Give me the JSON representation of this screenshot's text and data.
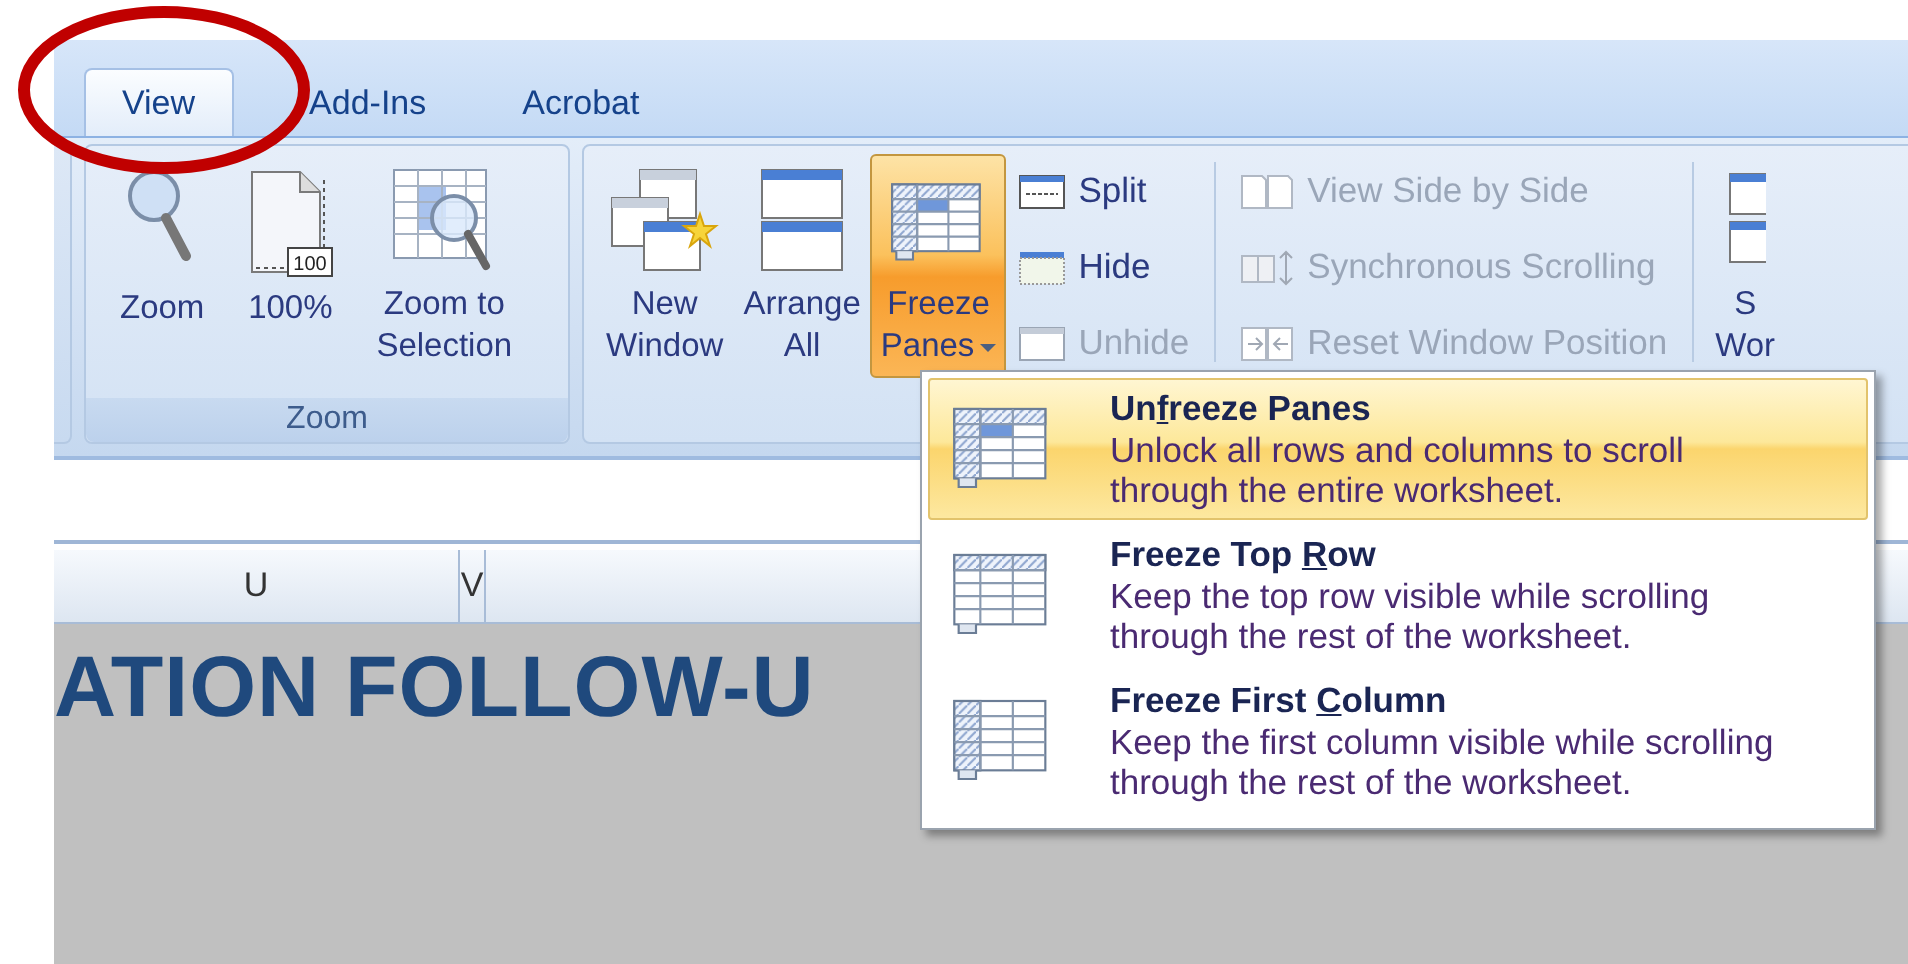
{
  "tabs": [
    {
      "label": "View",
      "selected": true
    },
    {
      "label": "Add-Ins",
      "selected": false
    },
    {
      "label": "Acrobat",
      "selected": false
    }
  ],
  "ribbon_groups": [
    {
      "label": "Zoom",
      "buttons": [
        {
          "kind": "large",
          "lines": [
            "Zoom"
          ]
        },
        {
          "kind": "large",
          "lines": [
            "100%"
          ],
          "icon_text": "100"
        },
        {
          "kind": "large",
          "lines": [
            "Zoom to",
            "Selection"
          ]
        }
      ]
    },
    {
      "buttons": [
        {
          "kind": "large",
          "lines": [
            "New",
            "Window"
          ]
        },
        {
          "kind": "large",
          "lines": [
            "Arrange",
            "All"
          ]
        },
        {
          "kind": "large",
          "lines": [
            "Freeze",
            "Panes"
          ],
          "pressed": true,
          "dropdown": true
        },
        {
          "kind": "column",
          "items": [
            {
              "label": "Split",
              "disabled": false
            },
            {
              "label": "Hide",
              "disabled": false
            },
            {
              "label": "Unhide",
              "disabled": true
            }
          ]
        },
        {
          "kind": "column",
          "items": [
            {
              "label": "View Side by Side",
              "disabled": true
            },
            {
              "label": "Synchronous Scrolling",
              "disabled": true
            },
            {
              "label": "Reset Window Position",
              "disabled": true
            }
          ]
        },
        {
          "kind": "large",
          "lines": [
            "S",
            "Wor"
          ]
        }
      ]
    }
  ],
  "columns": [
    {
      "label": "U"
    },
    {
      "label": "V"
    }
  ],
  "sheet_text": "ATION FOLLOW-U",
  "menu": [
    {
      "title_parts": [
        "Un",
        "f",
        "reeze Panes"
      ],
      "description": "Unlock all rows and columns to scroll through the entire worksheet.",
      "selected": true
    },
    {
      "title_parts": [
        "Freeze Top ",
        "R",
        "ow"
      ],
      "description": "Keep the top row visible while scrolling through the rest of the worksheet.",
      "selected": false
    },
    {
      "title_parts": [
        "Freeze First ",
        "C",
        "olumn"
      ],
      "description": "Keep the first column visible while scrolling through the rest of the worksheet.",
      "selected": false
    }
  ]
}
